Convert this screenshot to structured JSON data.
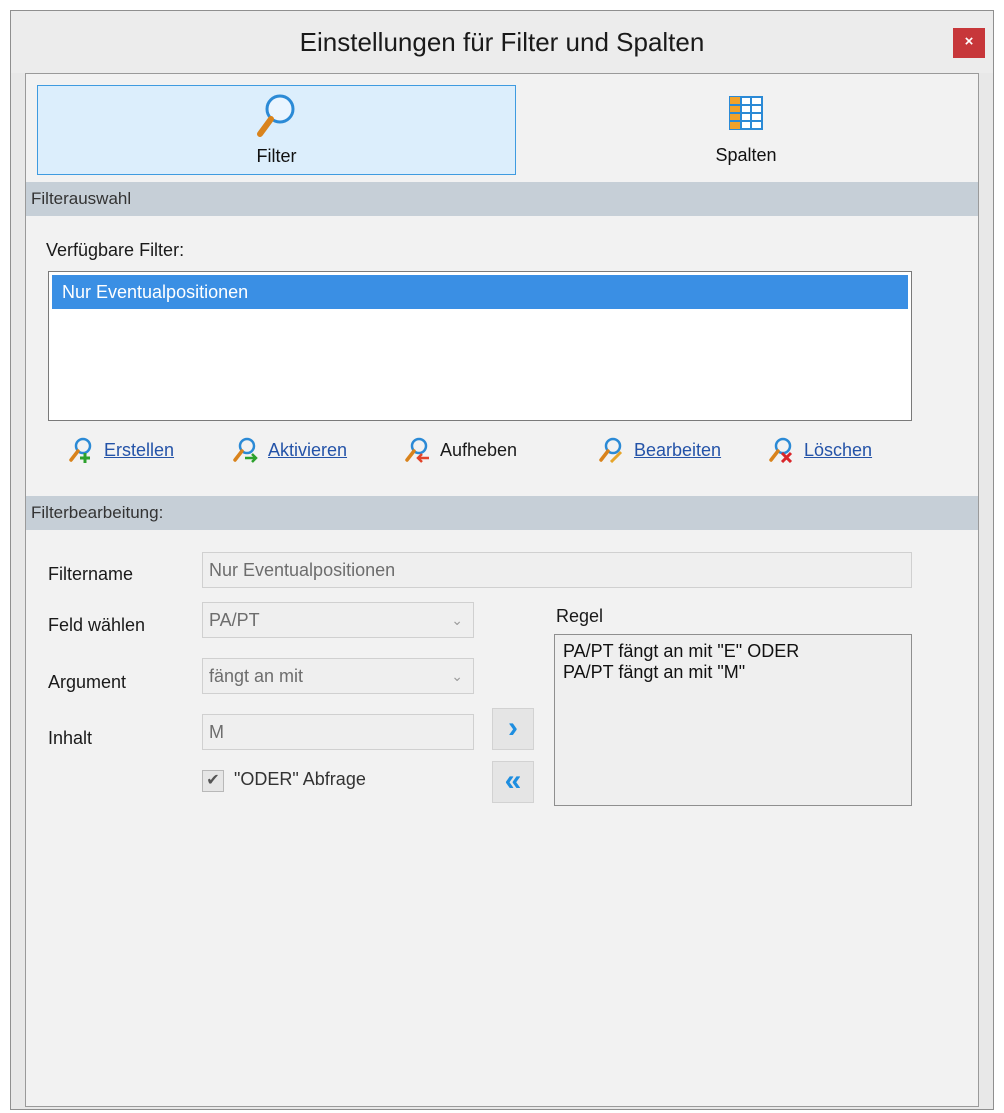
{
  "window": {
    "title": "Einstellungen für Filter und Spalten",
    "close_label": "×"
  },
  "tabs": [
    {
      "label": "Filter",
      "icon": "magnifier-icon",
      "selected": true
    },
    {
      "label": "Spalten",
      "icon": "table-columns-icon",
      "selected": false
    }
  ],
  "filterauswahl": {
    "header": "Filterauswahl",
    "list_label": "Verfügbare Filter:",
    "items": [
      "Nur Eventualpositionen"
    ],
    "selected_index": 0,
    "actions": [
      {
        "label": "Erstellen",
        "icon": "filter-create-icon",
        "enabled": true
      },
      {
        "label": "Aktivieren",
        "icon": "filter-activate-icon",
        "enabled": true
      },
      {
        "label": "Aufheben",
        "icon": "filter-remove-icon",
        "enabled": false
      },
      {
        "label": "Bearbeiten",
        "icon": "filter-edit-icon",
        "enabled": true
      },
      {
        "label": "Löschen",
        "icon": "filter-delete-icon",
        "enabled": true
      }
    ]
  },
  "filterbearbeitung": {
    "header": "Filterbearbeitung:",
    "filtername_label": "Filtername",
    "filtername_value": "Nur Eventualpositionen",
    "feld_label": "Feld wählen",
    "feld_value": "PA/PT",
    "argument_label": "Argument",
    "argument_value": "fängt an mit",
    "inhalt_label": "Inhalt",
    "inhalt_value": "M",
    "oder_label": "\"ODER\" Abfrage",
    "oder_checked": true,
    "regel_label": "Regel",
    "regel_lines": [
      "PA/PT fängt an mit \"E\" ODER",
      "PA/PT fängt an mit \"M\""
    ],
    "add_button": "›",
    "clear_button": "«"
  },
  "colors": {
    "accent": "#3a8fe4",
    "tab_selected_bg": "#dceefc",
    "section_header": "#c6cfd7",
    "close": "#c7373a"
  }
}
